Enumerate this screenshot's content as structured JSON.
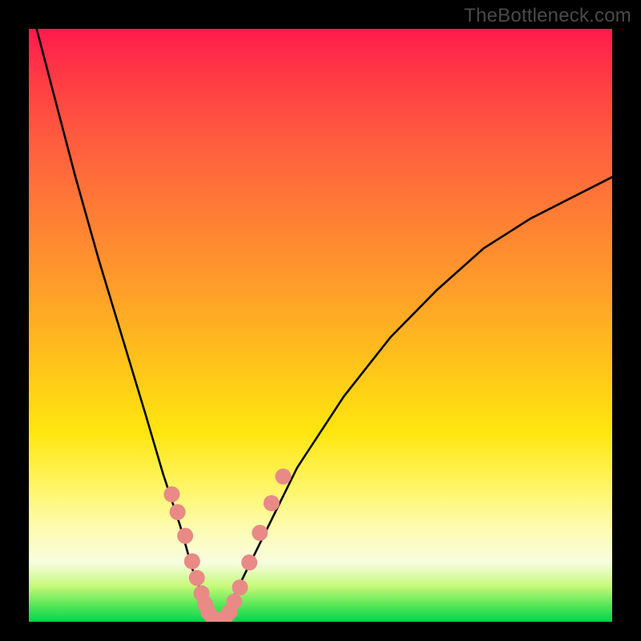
{
  "watermark": {
    "text": "TheBottleneck.com"
  },
  "chart_data": {
    "type": "line",
    "title": "",
    "xlabel": "",
    "ylabel": "",
    "xlim": [
      0,
      100
    ],
    "ylim": [
      0,
      100
    ],
    "series": [
      {
        "name": "bottleneck-curve",
        "x": [
          0,
          4,
          8,
          12,
          16,
          20,
          23,
          26,
          28,
          30,
          31.5,
          33,
          34,
          35,
          40,
          46,
          54,
          62,
          70,
          78,
          86,
          94,
          100
        ],
        "y": [
          105,
          90,
          75,
          61,
          48,
          35,
          25,
          16,
          9,
          4,
          1,
          0,
          1,
          4,
          14,
          26,
          38,
          48,
          56,
          63,
          68,
          72,
          75
        ]
      }
    ],
    "markers": {
      "name": "sample-points",
      "color": "#e98a87",
      "radius_px": 10,
      "x": [
        24.5,
        25.5,
        26.8,
        28.0,
        28.8,
        29.6,
        30.2,
        30.8,
        31.6,
        32.6,
        33.6,
        34.4,
        35.2,
        36.2,
        37.8,
        39.6,
        41.6,
        43.6
      ],
      "y": [
        21.5,
        18.5,
        14.5,
        10.2,
        7.4,
        4.8,
        3.0,
        1.6,
        0.6,
        0.3,
        0.6,
        1.6,
        3.4,
        5.8,
        10.0,
        15.0,
        20.0,
        24.5
      ]
    },
    "gradient_stops": [
      {
        "pct": 0,
        "color": "#ff1a4d"
      },
      {
        "pct": 45,
        "color": "#ffa128"
      },
      {
        "pct": 68,
        "color": "#ffe60f"
      },
      {
        "pct": 90,
        "color": "#f7fde0"
      },
      {
        "pct": 100,
        "color": "#05d34a"
      }
    ]
  }
}
